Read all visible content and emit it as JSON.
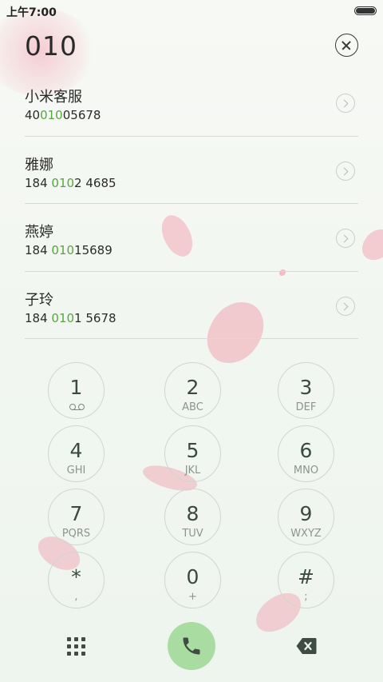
{
  "status_bar": {
    "time": "上午7:00"
  },
  "dialer": {
    "number": "010"
  },
  "results": [
    {
      "name": "小米客服",
      "number_pre": "40",
      "number_match": "010",
      "number_post": "05678"
    },
    {
      "name": "雅娜",
      "number_pre": "184 ",
      "number_match": "010",
      "number_post": "2 4685"
    },
    {
      "name": "燕婷",
      "number_pre": "184 ",
      "number_match": "010",
      "number_post": "15689"
    },
    {
      "name": "子玲",
      "number_pre": "184 ",
      "number_match": "010",
      "number_post": "1 5678"
    }
  ],
  "keypad": [
    {
      "digit": "1",
      "sub": ""
    },
    {
      "digit": "2",
      "sub": "ABC"
    },
    {
      "digit": "3",
      "sub": "DEF"
    },
    {
      "digit": "4",
      "sub": "GHI"
    },
    {
      "digit": "5",
      "sub": "JKL"
    },
    {
      "digit": "6",
      "sub": "MNO"
    },
    {
      "digit": "7",
      "sub": "PQRS"
    },
    {
      "digit": "8",
      "sub": "TUV"
    },
    {
      "digit": "9",
      "sub": "WXYZ"
    },
    {
      "digit": "*",
      "sub": ","
    },
    {
      "digit": "0",
      "sub": "+"
    },
    {
      "digit": "#",
      "sub": ";"
    }
  ],
  "icons": {
    "voicemail": "voicemail-icon",
    "dialpad": "dialpad-icon",
    "call": "phone-icon",
    "backspace": "backspace-icon",
    "clear": "close-icon",
    "detail": "chevron-right-icon"
  },
  "colors": {
    "highlight": "#56a540",
    "call_button": "#a9dca0",
    "icon_dark": "#3e4c43"
  }
}
